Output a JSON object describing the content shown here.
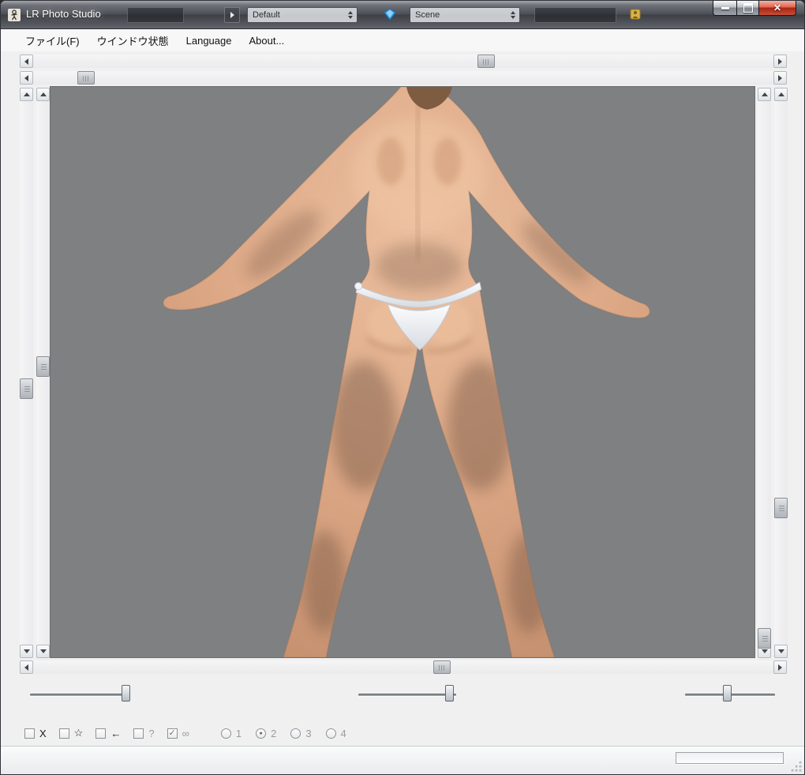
{
  "window": {
    "title": "LR Photo Studio",
    "close_glyph": "✕"
  },
  "titlebar_fields": {
    "combo1": "Default",
    "combo2": "Scene"
  },
  "menu": {
    "items": [
      {
        "label": "ファイル(F)"
      },
      {
        "label": "ウインドウ状態"
      },
      {
        "label": "Language"
      },
      {
        "label": "About..."
      }
    ]
  },
  "viewport": {
    "background_color": "#7e8082"
  },
  "scrollbars": {
    "h_top1": {
      "pos": 60
    },
    "h_top2": {
      "pos": 6
    },
    "h_bottom": {
      "pos": 54
    },
    "v_left_outer": {
      "pos": 51
    },
    "v_left_inner": {
      "pos": 47
    },
    "v_right_inner": {
      "pos": 97
    },
    "v_right_outer": {
      "pos": 73
    }
  },
  "sliders": {
    "s1": 92,
    "s2": 89,
    "s3": 48
  },
  "checkboxes": [
    {
      "label": "X",
      "checked": false,
      "mark": ""
    },
    {
      "label": "☆",
      "checked": false,
      "mark": ""
    },
    {
      "label": "←",
      "checked": false,
      "mark": ""
    },
    {
      "label": "?",
      "checked": false,
      "mark": ""
    },
    {
      "label": "∞",
      "checked": true,
      "mark": "✓"
    }
  ],
  "radios": [
    {
      "label": "1",
      "selected": false,
      "mark": ""
    },
    {
      "label": "2",
      "selected": true,
      "mark": "●"
    },
    {
      "label": "3",
      "selected": false,
      "mark": ""
    },
    {
      "label": "4",
      "selected": false,
      "mark": ""
    }
  ],
  "colors": {
    "close_button_red": "#a82413",
    "titlebar_glass": "#4c5056",
    "viewport_gray": "#7e8082"
  }
}
